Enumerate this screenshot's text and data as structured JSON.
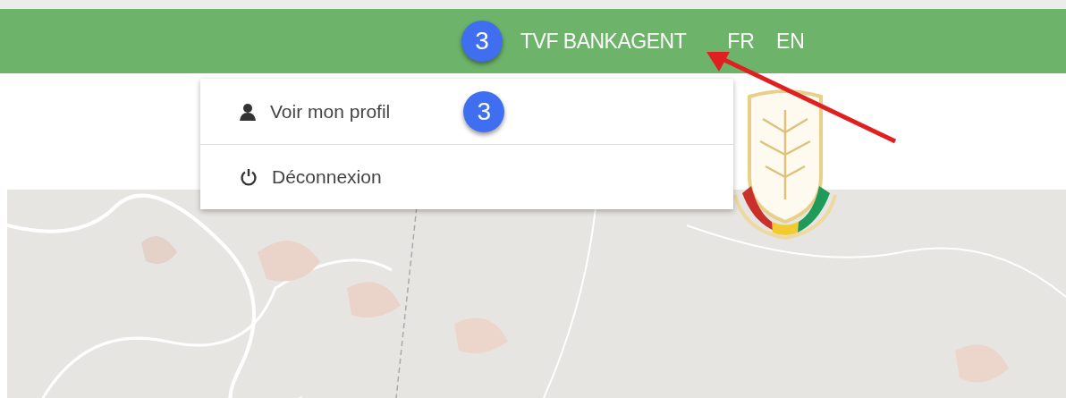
{
  "header": {
    "user_badge": "3",
    "user_name": "TVF BANKAGENT",
    "languages": [
      {
        "label": "FR"
      },
      {
        "label": "EN"
      }
    ]
  },
  "user_menu": {
    "items": [
      {
        "kind": "profile",
        "label": "Voir mon profil",
        "badge": "3"
      },
      {
        "kind": "logout",
        "label": "Déconnexion"
      }
    ]
  }
}
